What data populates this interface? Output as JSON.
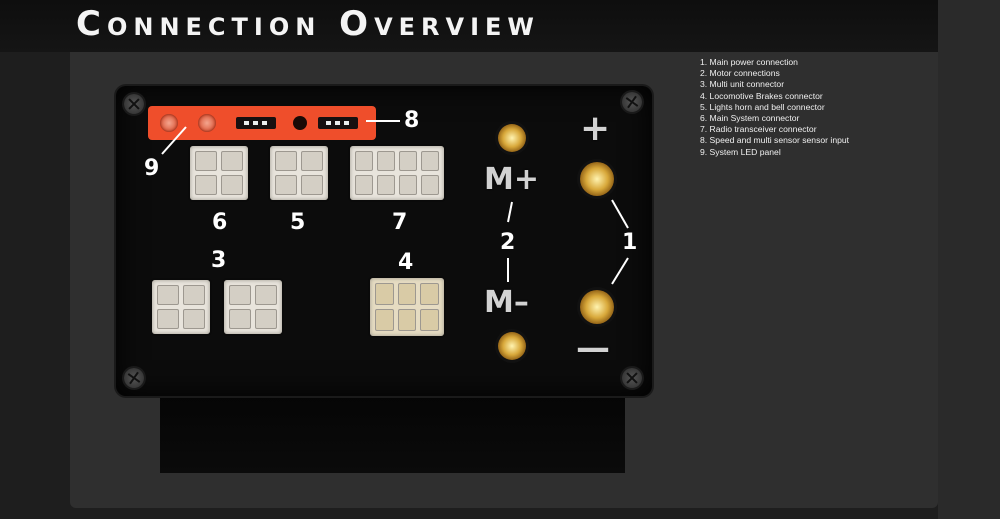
{
  "header": {
    "title": "Connection Overview"
  },
  "legend": [
    "1. Main power connection",
    "2. Motor connections",
    "3. Multi unit connector",
    "4. Locomotive Brakes connector",
    "5. Lights horn and bell connector",
    "6. Main System connector",
    "7. Radio transceiver connector",
    "8. Speed and multi sensor sensor input",
    "9. System LED panel"
  ],
  "board": {
    "callouts": {
      "power": "1",
      "motor": "2",
      "multi_unit": "3",
      "brakes": "4",
      "lights": "5",
      "main_system": "6",
      "radio": "7",
      "sensor": "8",
      "led_panel": "9"
    },
    "motor_plus": "M+",
    "motor_minus": "M–",
    "power_plus": "+",
    "power_minus": "—"
  },
  "colors": {
    "led_panel": "#ef4e2b",
    "terminal_gold": "#d8a83a",
    "connector_white": "#e8e4dc"
  }
}
